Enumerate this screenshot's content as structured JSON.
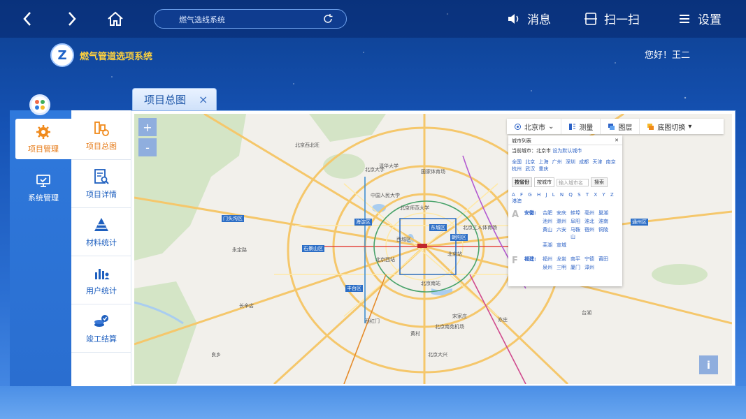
{
  "topbar": {
    "address_text": "燃气选线系统",
    "message_label": "消息",
    "scan_label": "扫一扫",
    "settings_label": "设置"
  },
  "brand": {
    "logo_letter": "Z",
    "title": "燃气管道选项系统"
  },
  "greeting": "您好！王二",
  "leftnav": [
    {
      "label": "项目管理",
      "icon": "gear-icon",
      "active": true
    },
    {
      "label": "系统管理",
      "icon": "monitor-icon",
      "active": false
    }
  ],
  "subnav": [
    {
      "label": "项目总图",
      "icon": "project-overview-icon",
      "active": true
    },
    {
      "label": "项目详情",
      "icon": "document-search-icon",
      "active": false
    },
    {
      "label": "材料统计",
      "icon": "pyramid-chart-icon",
      "active": false
    },
    {
      "label": "用户统计",
      "icon": "user-chart-icon",
      "active": false
    },
    {
      "label": "竣工结算",
      "icon": "coins-check-icon",
      "active": false
    }
  ],
  "tab": {
    "label": "项目总图",
    "close": "×"
  },
  "map": {
    "zoom_in": "+",
    "zoom_out": "-",
    "info": "i",
    "toolbar": {
      "city": "北京市",
      "measure": "测量",
      "layers": "图层",
      "basemap": "底图切换"
    },
    "city_panel": {
      "title": "城市列表",
      "current_label": "当前城市：北京市",
      "set_default": "设为默认城市",
      "national": "全国",
      "hot_cities": [
        "北京",
        "上海",
        "广州",
        "深圳",
        "成都",
        "天津",
        "南京",
        "杭州",
        "武汉",
        "重庆"
      ],
      "tab_province": "按省份",
      "tab_city": "按城市",
      "input_placeholder": "输入城市名",
      "search_btn": "搜索",
      "letters": [
        "A",
        "F",
        "G",
        "H",
        "J",
        "L",
        "N",
        "Q",
        "S",
        "T",
        "X",
        "Y",
        "Z"
      ],
      "letters_extra": "港澳",
      "groups": [
        {
          "letter": "A",
          "province": "安徽:",
          "cities": [
            "合肥",
            "安庆",
            "蚌埠",
            "亳州",
            "巢湖",
            "池州",
            "滁州",
            "阜阳",
            "淮北",
            "淮南",
            "黄山",
            "六安",
            "马鞍山",
            "宿州",
            "铜陵",
            "芜湖",
            "宣城"
          ]
        },
        {
          "letter": "F",
          "province": "福建:",
          "cities": [
            "福州",
            "龙岩",
            "南平",
            "宁德",
            "莆田",
            "泉州",
            "三明",
            "厦门",
            "漳州"
          ]
        }
      ]
    },
    "labels": [
      "北京大学",
      "清华大学",
      "中国人民大学",
      "北京师范大学",
      "海淀区",
      "东城区",
      "朝阳区",
      "西城区",
      "门头沟区",
      "石景山区",
      "丰台区",
      "北京西站",
      "北京站",
      "北京南站",
      "北京工人体育场",
      "北京西北旺",
      "国家体育场",
      "北京大兴",
      "通州区",
      "北京南苑机场",
      "永定路",
      "长辛店",
      "良乡",
      "台湖",
      "亦庄",
      "黄村",
      "宋家庄",
      "西红门"
    ]
  }
}
